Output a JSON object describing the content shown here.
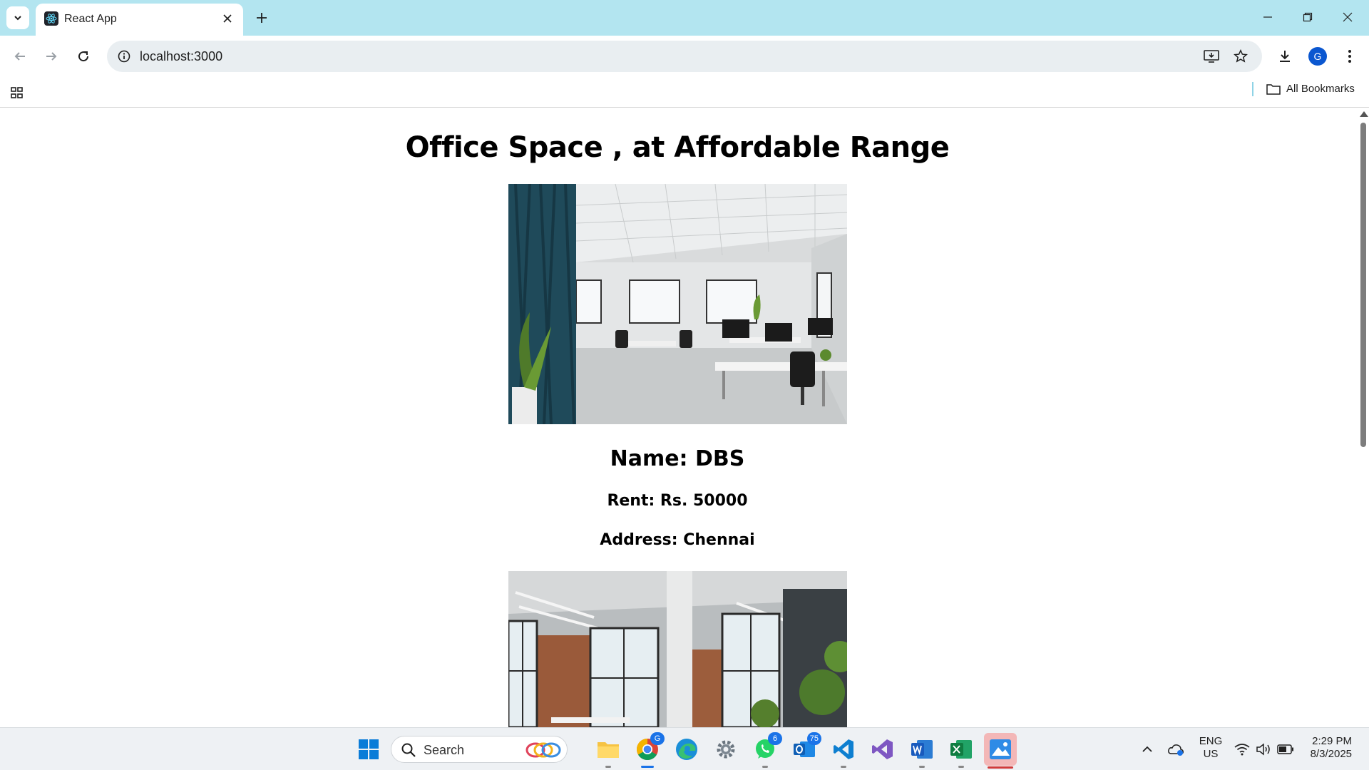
{
  "browser": {
    "tab_title": "React App",
    "url": "localhost:3000",
    "bookmarks_label": "All Bookmarks",
    "profile_initial": "G",
    "accent_color": "#b3e5f0"
  },
  "page": {
    "title": "Office Space , at Affordable Range",
    "listings": [
      {
        "name_label": "Name:",
        "name": "DBS",
        "rent_label": "Rent: Rs.",
        "rent": "50000",
        "address_label": "Address:",
        "address": "Chennai"
      }
    ]
  },
  "taskbar": {
    "search_label": "Search",
    "chrome_badge": "G",
    "whatsapp_badge": "6",
    "outlook_badge": "75",
    "language": "ENG",
    "region": "US",
    "time": "2:29 PM",
    "date": "8/3/2025"
  }
}
